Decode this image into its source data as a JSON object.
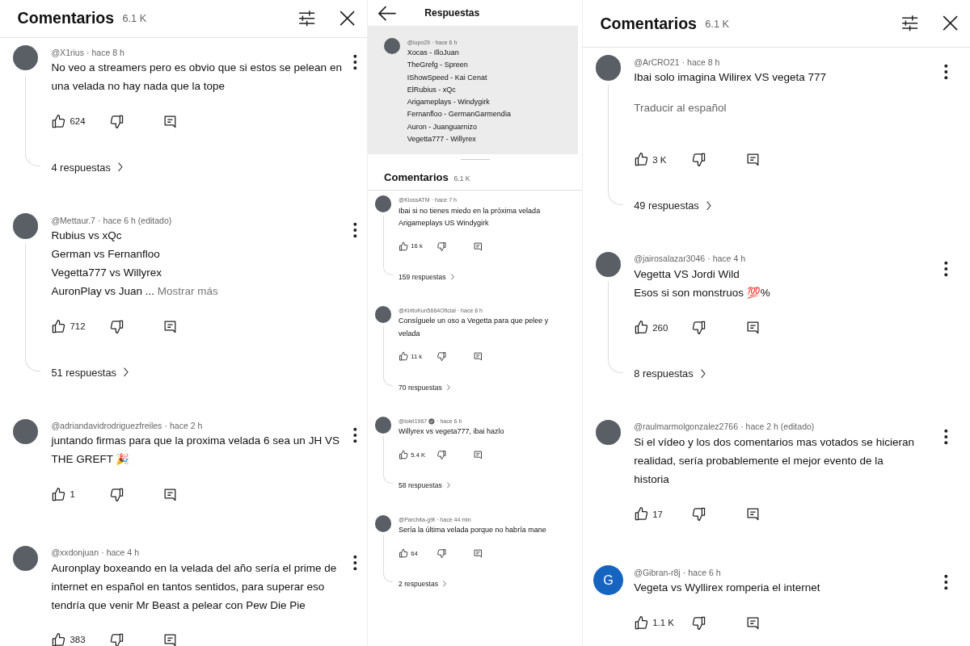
{
  "panels": [
    {
      "kind": "comments",
      "header": {
        "title": "Comentarios",
        "count": "6.1 K"
      },
      "comments": [
        {
          "avatar": {
            "kind": "photo"
          },
          "author": "@X1rius",
          "verified": false,
          "time": "· hace 8 h",
          "lines": [
            "No veo a streamers pero es obvio que si estos se pelean en",
            "una velada no hay nada que la tope"
          ],
          "likes": "624",
          "replies": "4 respuestas"
        },
        {
          "avatar": {
            "kind": "photo"
          },
          "author": "@Mettaur.7",
          "verified": false,
          "time": "· hace 6 h (editado)",
          "lines": [
            "Rubius vs xQc",
            "German vs Fernanfloo",
            "Vegetta777 vs Willyrex",
            "AuronPlay vs Juan ..."
          ],
          "more": "Mostrar más",
          "likes": "712",
          "replies": "51 respuestas"
        },
        {
          "avatar": {
            "kind": "photo"
          },
          "author": "@adriandavidrodriguezfreiles",
          "verified": false,
          "time": "· hace 2 h",
          "lines": [
            "juntando firmas para que la proxima velada 6 sea un JH VS",
            "THE GREFT 🎉"
          ],
          "likes": "1"
        },
        {
          "avatar": {
            "kind": "photo"
          },
          "author": "@xxdonjuan",
          "verified": false,
          "time": "· hace 4 h",
          "lines": [
            "Auronplay boxeando en la velada del año sería el prime de",
            "internet en español en tantos sentidos, para superar eso",
            "tendría que venir Mr Beast a pelear con Pew Die Pie"
          ],
          "likes": "383"
        }
      ]
    },
    {
      "kind": "replies",
      "header": {
        "title": "Respuestas"
      },
      "parent": {
        "avatar": {
          "kind": "photo"
        },
        "author": "@lupo29",
        "verified": false,
        "time": "· hace 6 h",
        "lines": [
          "Xocas - IlloJuan",
          "TheGrefg - Spreen",
          "IShowSpeed - Kai Cenat",
          "ElRubius - xQc",
          "Arigameplays - Windygirk",
          "Fernanfloo - GermanGarmendia",
          "Auron - Juanguarnizo",
          "Vegetta777 - Willyrex"
        ]
      },
      "sub_header": {
        "title": "Comentarios",
        "count": "6.1 K"
      },
      "comments": [
        {
          "avatar": {
            "kind": "photo"
          },
          "author": "@KlossATM",
          "verified": false,
          "time": "· hace 7 h",
          "lines": [
            "Ibai si no tienes miedo en la próxima velada",
            "Arigameplays US Windygirk"
          ],
          "likes": "16 k",
          "replies": "159 respuestas"
        },
        {
          "avatar": {
            "kind": "photo"
          },
          "author": "@KiritoKun5664Oficial",
          "verified": false,
          "time": "· hace 8 h",
          "lines": [
            "Consíguele un oso a Vegetta para que pelee y",
            "velada"
          ],
          "likes": "11 k",
          "replies": "70 respuestas"
        },
        {
          "avatar": {
            "kind": "photo"
          },
          "author": "@lolel1967",
          "verified": true,
          "time": "· hace 6 h",
          "lines": [
            "Willyrex vs vegeta777, ibai hazlo"
          ],
          "likes": "5.4 K",
          "replies": "58 respuestas"
        },
        {
          "avatar": {
            "kind": "photo"
          },
          "author": "@Parchita-g9t",
          "verified": false,
          "time": "· hace 44 min",
          "lines": [
            "Sería la última velada porque no habría mane"
          ],
          "likes": "64",
          "replies": "2 respuestas"
        }
      ]
    },
    {
      "kind": "comments",
      "header": {
        "title": "Comentarios",
        "count": "6.1 K"
      },
      "comments": [
        {
          "avatar": {
            "kind": "photo"
          },
          "author": "@ArCRO21",
          "verified": false,
          "time": "· hace 8 h",
          "lines": [
            "Ibai solo imagina Wilirex VS vegeta 777"
          ],
          "translate": "Traducir al español",
          "likes": "3 K",
          "replies": "49 respuestas"
        },
        {
          "avatar": {
            "kind": "photo"
          },
          "author": "@jairosalazar3046",
          "verified": false,
          "time": "· hace 4 h",
          "lines": [
            "Vegetta VS Jordi Wild",
            "Esos si son monstruos 💯%"
          ],
          "likes": "260",
          "replies": "8 respuestas"
        },
        {
          "avatar": {
            "kind": "photo"
          },
          "author": "@raulmarmolgonzalez2766",
          "verified": false,
          "time": "· hace 2 h (editado)",
          "lines": [
            "Si el vídeo y los dos comentarios mas votados se hicieran",
            "realidad, sería probablemente el mejor evento de la",
            "historia"
          ],
          "likes": "17"
        },
        {
          "avatar": {
            "kind": "letter",
            "letter": "G",
            "color": "#1565c0"
          },
          "author": "@Gibran-r8j",
          "verified": false,
          "time": "· hace 6 h",
          "lines": [
            "Vegeta vs Wyllirex romperia el internet"
          ],
          "likes": "1.1 K"
        }
      ]
    }
  ]
}
